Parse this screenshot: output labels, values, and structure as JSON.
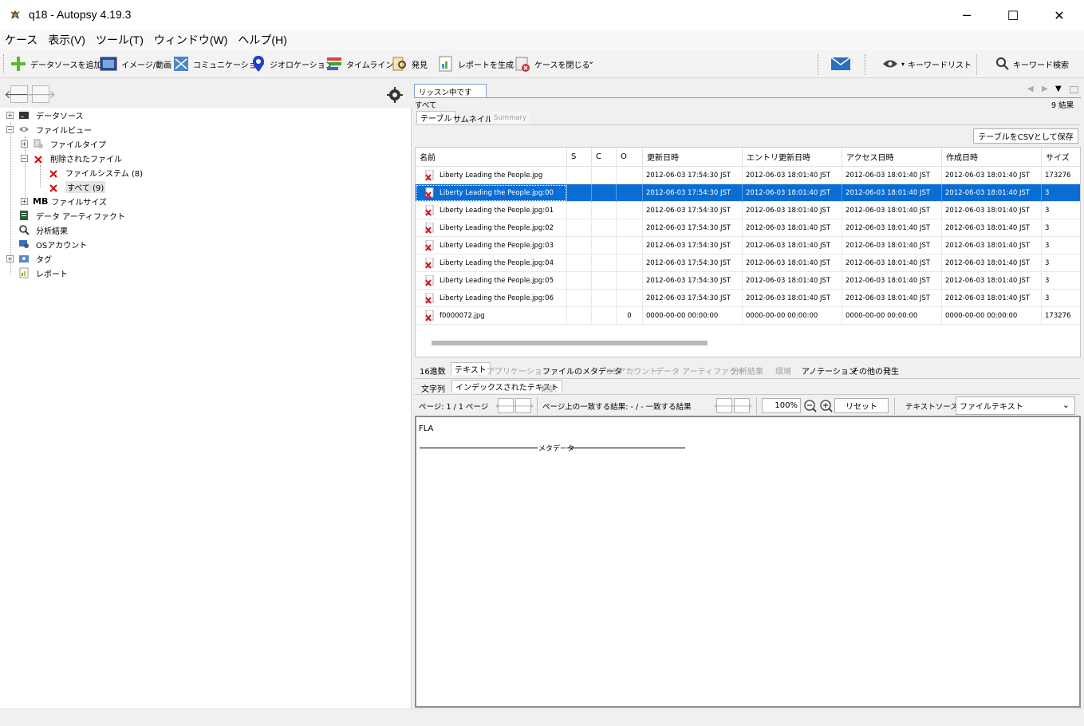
{
  "window": {
    "title": "q18 - Autopsy 4.19.3",
    "min_glyph": "─",
    "max_glyph": "☐",
    "close_glyph": "✕"
  },
  "menu": [
    "ケース",
    "表示(V)",
    "ツール(T)",
    "ウィンドウ(W)",
    "ヘルプ(H)"
  ],
  "toolbar": {
    "add_datasource": "データソースを追加",
    "images_video": "イメージ/動画",
    "communication": "コミュニケーション",
    "geolocation": "ジオロケーション",
    "timeline": "タイムライン",
    "discovery": "発見",
    "generate_report": "レポートを生成",
    "close_case": "ケースを閉じる",
    "keyword_list": "キーワードリスト",
    "keyword_search": "キーワード検索"
  },
  "tree": {
    "datasource": "データソース",
    "fileview": "ファイルビュー",
    "filetype": "ファイルタイプ",
    "deleted": "削除されたファイル",
    "filesystem": "ファイルシステム (8)",
    "all": "すべて (9)",
    "mb_prefix": "MB",
    "filesize": "ファイルサイズ",
    "data_artifacts": "データ アーティファクト",
    "analysis_results": "分析結果",
    "os_accounts": "OSアカウント",
    "tags": "タグ",
    "reports": "レポート"
  },
  "result": {
    "tab_label": "リッスン中です",
    "path": "すべて",
    "count": "9  結果",
    "tabs": [
      "テーブル",
      "サムネイル",
      "Summary"
    ],
    "save_csv": "テーブルをCSVとして保存",
    "columns": [
      "名前",
      "S",
      "C",
      "O",
      "更新日時",
      "エントリ更新日時",
      "アクセス日時",
      "作成日時",
      "サイズ"
    ],
    "rows": [
      {
        "name": "Liberty Leading the People.jpg",
        "o": "",
        "mod": "2012-06-03 17:54:30 JST",
        "chg": "2012-06-03 18:01:40 JST",
        "acc": "2012-06-03 18:01:40 JST",
        "cr": "2012-06-03 18:01:40 JST",
        "size": "173276"
      },
      {
        "name": "Liberty Leading the People.jpg:00",
        "o": "",
        "mod": "2012-06-03 17:54:30 JST",
        "chg": "2012-06-03 18:01:40 JST",
        "acc": "2012-06-03 18:01:40 JST",
        "cr": "2012-06-03 18:01:40 JST",
        "size": "3"
      },
      {
        "name": "Liberty Leading the People.jpg:01",
        "o": "",
        "mod": "2012-06-03 17:54:30 JST",
        "chg": "2012-06-03 18:01:40 JST",
        "acc": "2012-06-03 18:01:40 JST",
        "cr": "2012-06-03 18:01:40 JST",
        "size": "3"
      },
      {
        "name": "Liberty Leading the People.jpg:02",
        "o": "",
        "mod": "2012-06-03 17:54:30 JST",
        "chg": "2012-06-03 18:01:40 JST",
        "acc": "2012-06-03 18:01:40 JST",
        "cr": "2012-06-03 18:01:40 JST",
        "size": "3"
      },
      {
        "name": "Liberty Leading the People.jpg:03",
        "o": "",
        "mod": "2012-06-03 17:54:30 JST",
        "chg": "2012-06-03 18:01:40 JST",
        "acc": "2012-06-03 18:01:40 JST",
        "cr": "2012-06-03 18:01:40 JST",
        "size": "3"
      },
      {
        "name": "Liberty Leading the People.jpg:04",
        "o": "",
        "mod": "2012-06-03 17:54:30 JST",
        "chg": "2012-06-03 18:01:40 JST",
        "acc": "2012-06-03 18:01:40 JST",
        "cr": "2012-06-03 18:01:40 JST",
        "size": "3"
      },
      {
        "name": "Liberty Leading the People.jpg:05",
        "o": "",
        "mod": "2012-06-03 17:54:30 JST",
        "chg": "2012-06-03 18:01:40 JST",
        "acc": "2012-06-03 18:01:40 JST",
        "cr": "2012-06-03 18:01:40 JST",
        "size": "3"
      },
      {
        "name": "Liberty Leading the People.jpg:06",
        "o": "",
        "mod": "2012-06-03 17:54:30 JST",
        "chg": "2012-06-03 18:01:40 JST",
        "acc": "2012-06-03 18:01:40 JST",
        "cr": "2012-06-03 18:01:40 JST",
        "size": "3"
      },
      {
        "name": "f0000072.jpg",
        "o": "0",
        "mod": "0000-00-00 00:00:00",
        "chg": "0000-00-00 00:00:00",
        "acc": "0000-00-00 00:00:00",
        "cr": "0000-00-00 00:00:00",
        "size": "173276"
      }
    ],
    "selected_row": 1
  },
  "content": {
    "tabs": [
      "16進数",
      "テキスト",
      "アプリケーション",
      "ファイルのメタデータ",
      "OSアカウント",
      "データ アーティファクト",
      "分析結果",
      "環境",
      "アノテーション",
      "その他の発生"
    ],
    "subtabs": [
      "文字列",
      "インデックスされたテキスト",
      "翻訳"
    ],
    "page_label": "ページ: 1 / 1 ページ",
    "match_label": "ページ上の一致する結果: - / - 一致する結果",
    "zoom": "100%",
    "reset": "リセット",
    "text_source_label": "テキストソース:",
    "text_source_value": "ファイルテキスト",
    "body_line1": "FLA",
    "body_meta": "メタデータ"
  }
}
